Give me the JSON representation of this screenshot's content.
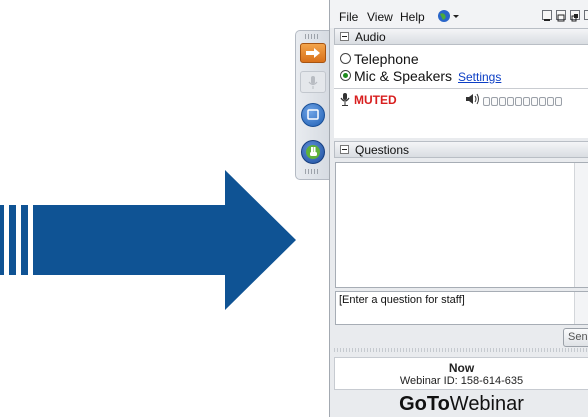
{
  "menu": {
    "items": [
      "File",
      "View",
      "Help"
    ]
  },
  "audio": {
    "title": "Audio",
    "options": [
      {
        "label": "Telephone",
        "selected": false
      },
      {
        "label": "Mic & Speakers",
        "selected": true
      }
    ],
    "settings_link": "Settings",
    "mute_status": "MUTED",
    "level_cells": 10
  },
  "questions": {
    "title": "Questions",
    "input_placeholder": "[Enter a question for staff]",
    "send_label": "Send"
  },
  "footer": {
    "session": "Now",
    "webinar_id": "Webinar ID: 158-614-635",
    "brand_bold": "GoTo",
    "brand_regular": "Webinar"
  },
  "colors": {
    "arrow": "#0f5394",
    "muted": "#d81e1e",
    "link": "#0b3ec5"
  }
}
